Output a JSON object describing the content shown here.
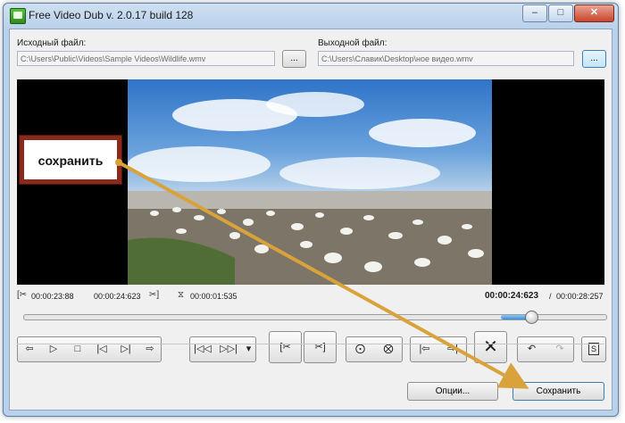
{
  "window": {
    "title": "Free Video Dub  v. 2.0.17 build 128",
    "minimize_icon": "minimize-icon",
    "maximize_icon": "maximize-icon",
    "close_icon": "close-icon"
  },
  "source": {
    "label": "Исходный файл:",
    "value": "C:\\Users\\Public\\Videos\\Sample Videos\\Wildlife.wmv",
    "browse_label": "..."
  },
  "output": {
    "label": "Выходной файл:",
    "value": "C:\\Users\\Славик\\Desktop\\ное видео.wmv",
    "browse_label": "..."
  },
  "times": {
    "start": "00:00:23:88",
    "end": "00:00:24:623",
    "duration": "00:00:01:535",
    "current": "00:00:24:623",
    "separator": "/",
    "total": "00:00:28:257"
  },
  "seek": {
    "position": 0.87
  },
  "toolbar": {
    "buttons": [
      {
        "name": "prev-frame-button",
        "icon": "step-back-icon",
        "glyph": "⇦"
      },
      {
        "name": "play-button",
        "icon": "play-icon",
        "glyph": "▷"
      },
      {
        "name": "stop-button",
        "icon": "stop-icon",
        "glyph": "□"
      },
      {
        "name": "prev-mark-button",
        "icon": "skip-back-icon",
        "glyph": "⏮"
      },
      {
        "name": "next-mark-button",
        "icon": "skip-forward-icon",
        "glyph": "⏭"
      },
      {
        "name": "next-frame-button",
        "icon": "step-forward-icon",
        "glyph": "⇨"
      }
    ]
  },
  "callout": {
    "text": "сохранить"
  },
  "footer": {
    "options_label": "Опции...",
    "save_label": "Сохранить"
  },
  "colors": {
    "callout_border": "#8a2a1c",
    "arrow": "#d9a23a",
    "accent": "#3a8ed8"
  }
}
